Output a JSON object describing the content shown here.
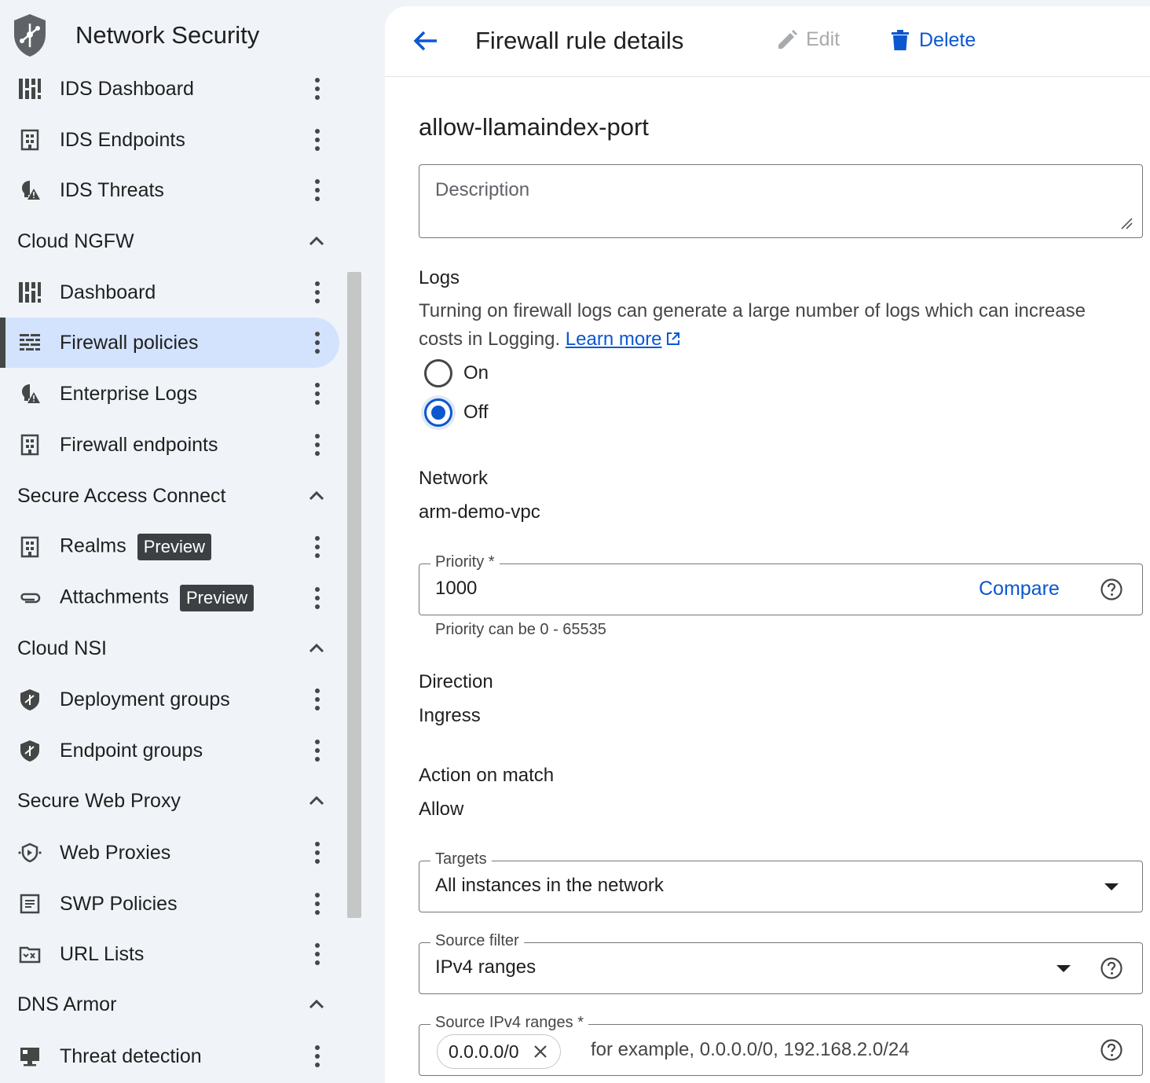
{
  "app": {
    "title": "Network Security"
  },
  "sidebar": {
    "items": [
      {
        "label": "IDS Dashboard",
        "icon": "dashboard-icon"
      },
      {
        "label": "IDS Endpoints",
        "icon": "endpoint-icon"
      },
      {
        "label": "IDS Threats",
        "icon": "threat-icon"
      },
      {
        "section": "Cloud NGFW"
      },
      {
        "label": "Dashboard",
        "icon": "dashboard-icon"
      },
      {
        "label": "Firewall policies",
        "icon": "firewall-icon",
        "active": true
      },
      {
        "label": "Enterprise Logs",
        "icon": "threat-icon"
      },
      {
        "label": "Firewall endpoints",
        "icon": "endpoint-icon"
      },
      {
        "section": "Secure Access Connect"
      },
      {
        "label": "Realms",
        "icon": "endpoint-icon",
        "badge": "Preview"
      },
      {
        "label": "Attachments",
        "icon": "attachment-icon",
        "badge": "Preview"
      },
      {
        "section": "Cloud NSI"
      },
      {
        "label": "Deployment groups",
        "icon": "shield-icon"
      },
      {
        "label": "Endpoint groups",
        "icon": "shield-icon"
      },
      {
        "section": "Secure Web Proxy"
      },
      {
        "label": "Web Proxies",
        "icon": "proxy-icon"
      },
      {
        "label": "SWP Policies",
        "icon": "policy-icon"
      },
      {
        "label": "URL Lists",
        "icon": "url-list-icon"
      },
      {
        "section": "DNS Armor"
      },
      {
        "label": "Threat detection",
        "icon": "monitor-icon"
      }
    ]
  },
  "header": {
    "title": "Firewall rule details",
    "edit_label": "Edit",
    "delete_label": "Delete"
  },
  "rule": {
    "name": "allow-llamaindex-port",
    "description_placeholder": "Description",
    "logs": {
      "heading": "Logs",
      "help": "Turning on firewall logs can generate a large number of logs which can increase costs in Logging.",
      "learn_more": "Learn more",
      "options": [
        "On",
        "Off"
      ],
      "selected": "Off"
    },
    "network": {
      "heading": "Network",
      "value": "arm-demo-vpc"
    },
    "priority": {
      "label": "Priority *",
      "value": "1000",
      "compare": "Compare",
      "hint": "Priority can be 0 - 65535"
    },
    "direction": {
      "heading": "Direction",
      "value": "Ingress"
    },
    "action": {
      "heading": "Action on match",
      "value": "Allow"
    },
    "targets": {
      "label": "Targets",
      "value": "All instances in the network"
    },
    "source_filter": {
      "label": "Source filter",
      "value": "IPv4 ranges"
    },
    "source_ranges": {
      "label": "Source IPv4 ranges *",
      "chips": [
        "0.0.0.0/0"
      ],
      "placeholder": "for example, 0.0.0.0/0, 192.168.2.0/24"
    }
  },
  "colors": {
    "accent": "#0b57d0",
    "active_nav": "#d3e3fd",
    "sidebar_bg": "#f0f4f9",
    "badge_bg": "#3c4043"
  }
}
